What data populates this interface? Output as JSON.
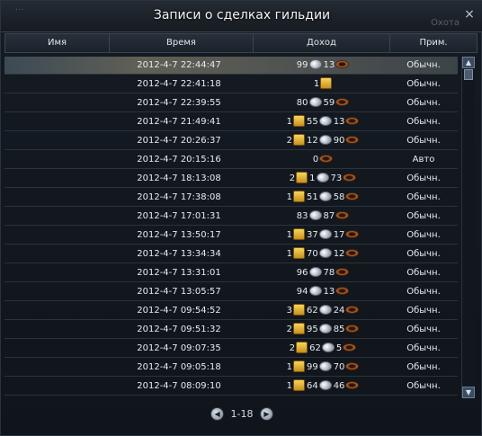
{
  "window": {
    "title": "Записи о сделках гильдии",
    "bg_left": "...",
    "bg_right": "Охота",
    "close_glyph": "×"
  },
  "columns": {
    "name": "Имя",
    "time": "Время",
    "income": "Доход",
    "note": "Прим."
  },
  "rows": [
    {
      "time": "2012-4-7 22:44:47",
      "gold": "",
      "silver": "99",
      "copper": "13",
      "note": "Обычн."
    },
    {
      "time": "2012-4-7 22:41:18",
      "gold": "1",
      "silver": "",
      "copper": "",
      "note": "Обычн."
    },
    {
      "time": "2012-4-7 22:39:55",
      "gold": "",
      "silver": "80",
      "copper": "59",
      "note": "Обычн."
    },
    {
      "time": "2012-4-7 21:49:41",
      "gold": "1",
      "silver": "55",
      "copper": "13",
      "note": "Обычн."
    },
    {
      "time": "2012-4-7 20:26:37",
      "gold": "2",
      "silver": "12",
      "copper": "90",
      "note": "Обычн."
    },
    {
      "time": "2012-4-7 20:15:16",
      "gold": "",
      "silver": "",
      "copper": "0",
      "note": "Авто"
    },
    {
      "time": "2012-4-7 18:13:08",
      "gold": "2",
      "silver": "1",
      "copper": "73",
      "note": "Обычн."
    },
    {
      "time": "2012-4-7 17:38:08",
      "gold": "1",
      "silver": "51",
      "copper": "58",
      "note": "Обычн."
    },
    {
      "time": "2012-4-7 17:01:31",
      "gold": "",
      "silver": "83",
      "copper": "87",
      "note": "Обычн."
    },
    {
      "time": "2012-4-7 13:50:17",
      "gold": "1",
      "silver": "37",
      "copper": "17",
      "note": "Обычн."
    },
    {
      "time": "2012-4-7 13:34:34",
      "gold": "1",
      "silver": "70",
      "copper": "12",
      "note": "Обычн."
    },
    {
      "time": "2012-4-7 13:31:01",
      "gold": "",
      "silver": "96",
      "copper": "78",
      "note": "Обычн."
    },
    {
      "time": "2012-4-7 13:05:57",
      "gold": "",
      "silver": "94",
      "copper": "13",
      "note": "Обычн."
    },
    {
      "time": "2012-4-7 09:54:52",
      "gold": "3",
      "silver": "62",
      "copper": "24",
      "note": "Обычн."
    },
    {
      "time": "2012-4-7 09:51:32",
      "gold": "2",
      "silver": "95",
      "copper": "85",
      "note": "Обычн."
    },
    {
      "time": "2012-4-7 09:07:35",
      "gold": "2",
      "silver": "62",
      "copper": "5",
      "note": "Обычн."
    },
    {
      "time": "2012-4-7 09:05:18",
      "gold": "1",
      "silver": "99",
      "copper": "70",
      "note": "Обычн."
    },
    {
      "time": "2012-4-7 08:09:10",
      "gold": "1",
      "silver": "64",
      "copper": "46",
      "note": "Обычн."
    }
  ],
  "selected_row": 0,
  "pager": {
    "label": "1-18",
    "prev_glyph": "◀",
    "next_glyph": "▶"
  },
  "scrollbar": {
    "up_glyph": "▲",
    "down_glyph": "▼"
  },
  "icons": {
    "gold": "gold-coin-icon",
    "silver": "silver-coin-icon",
    "copper": "copper-coin-icon"
  }
}
